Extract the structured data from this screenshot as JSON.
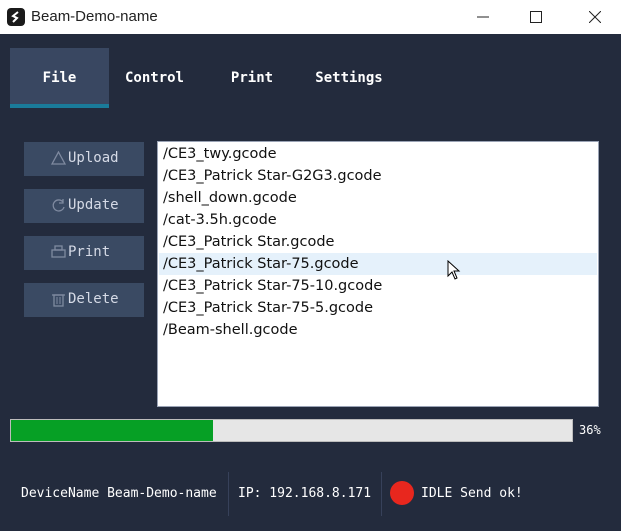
{
  "window": {
    "title": "Beam-Demo-name"
  },
  "tabs": [
    {
      "label": "File"
    },
    {
      "label": "Control"
    },
    {
      "label": "Print"
    },
    {
      "label": "Settings"
    }
  ],
  "active_tab": "File",
  "sidebar": {
    "upload_label": "Upload",
    "update_label": "Update",
    "print_label": "Print",
    "delete_label": "Delete"
  },
  "file_list": {
    "items": [
      "/CE3_twy.gcode",
      "/CE3_Patrick Star-G2G3.gcode",
      "/shell_down.gcode",
      "/cat-3.5h.gcode",
      "/CE3_Patrick Star.gcode",
      "/CE3_Patrick Star-75.gcode",
      "/CE3_Patrick Star-75-10.gcode",
      "/CE3_Patrick Star-75-5.gcode",
      "/Beam-shell.gcode"
    ],
    "highlighted_index": 5
  },
  "progress": {
    "value_percent": 36,
    "text": "36%"
  },
  "status": {
    "device": "DeviceName Beam-Demo-name",
    "ip": "IP: 192.168.8.171",
    "state": "IDLE Send ok!",
    "indicator_color": "#e8271e"
  },
  "colors": {
    "background": "#232b3d",
    "button": "#3a4a63",
    "progress": "#06a025",
    "tab_underline": "#1a7b9a"
  }
}
